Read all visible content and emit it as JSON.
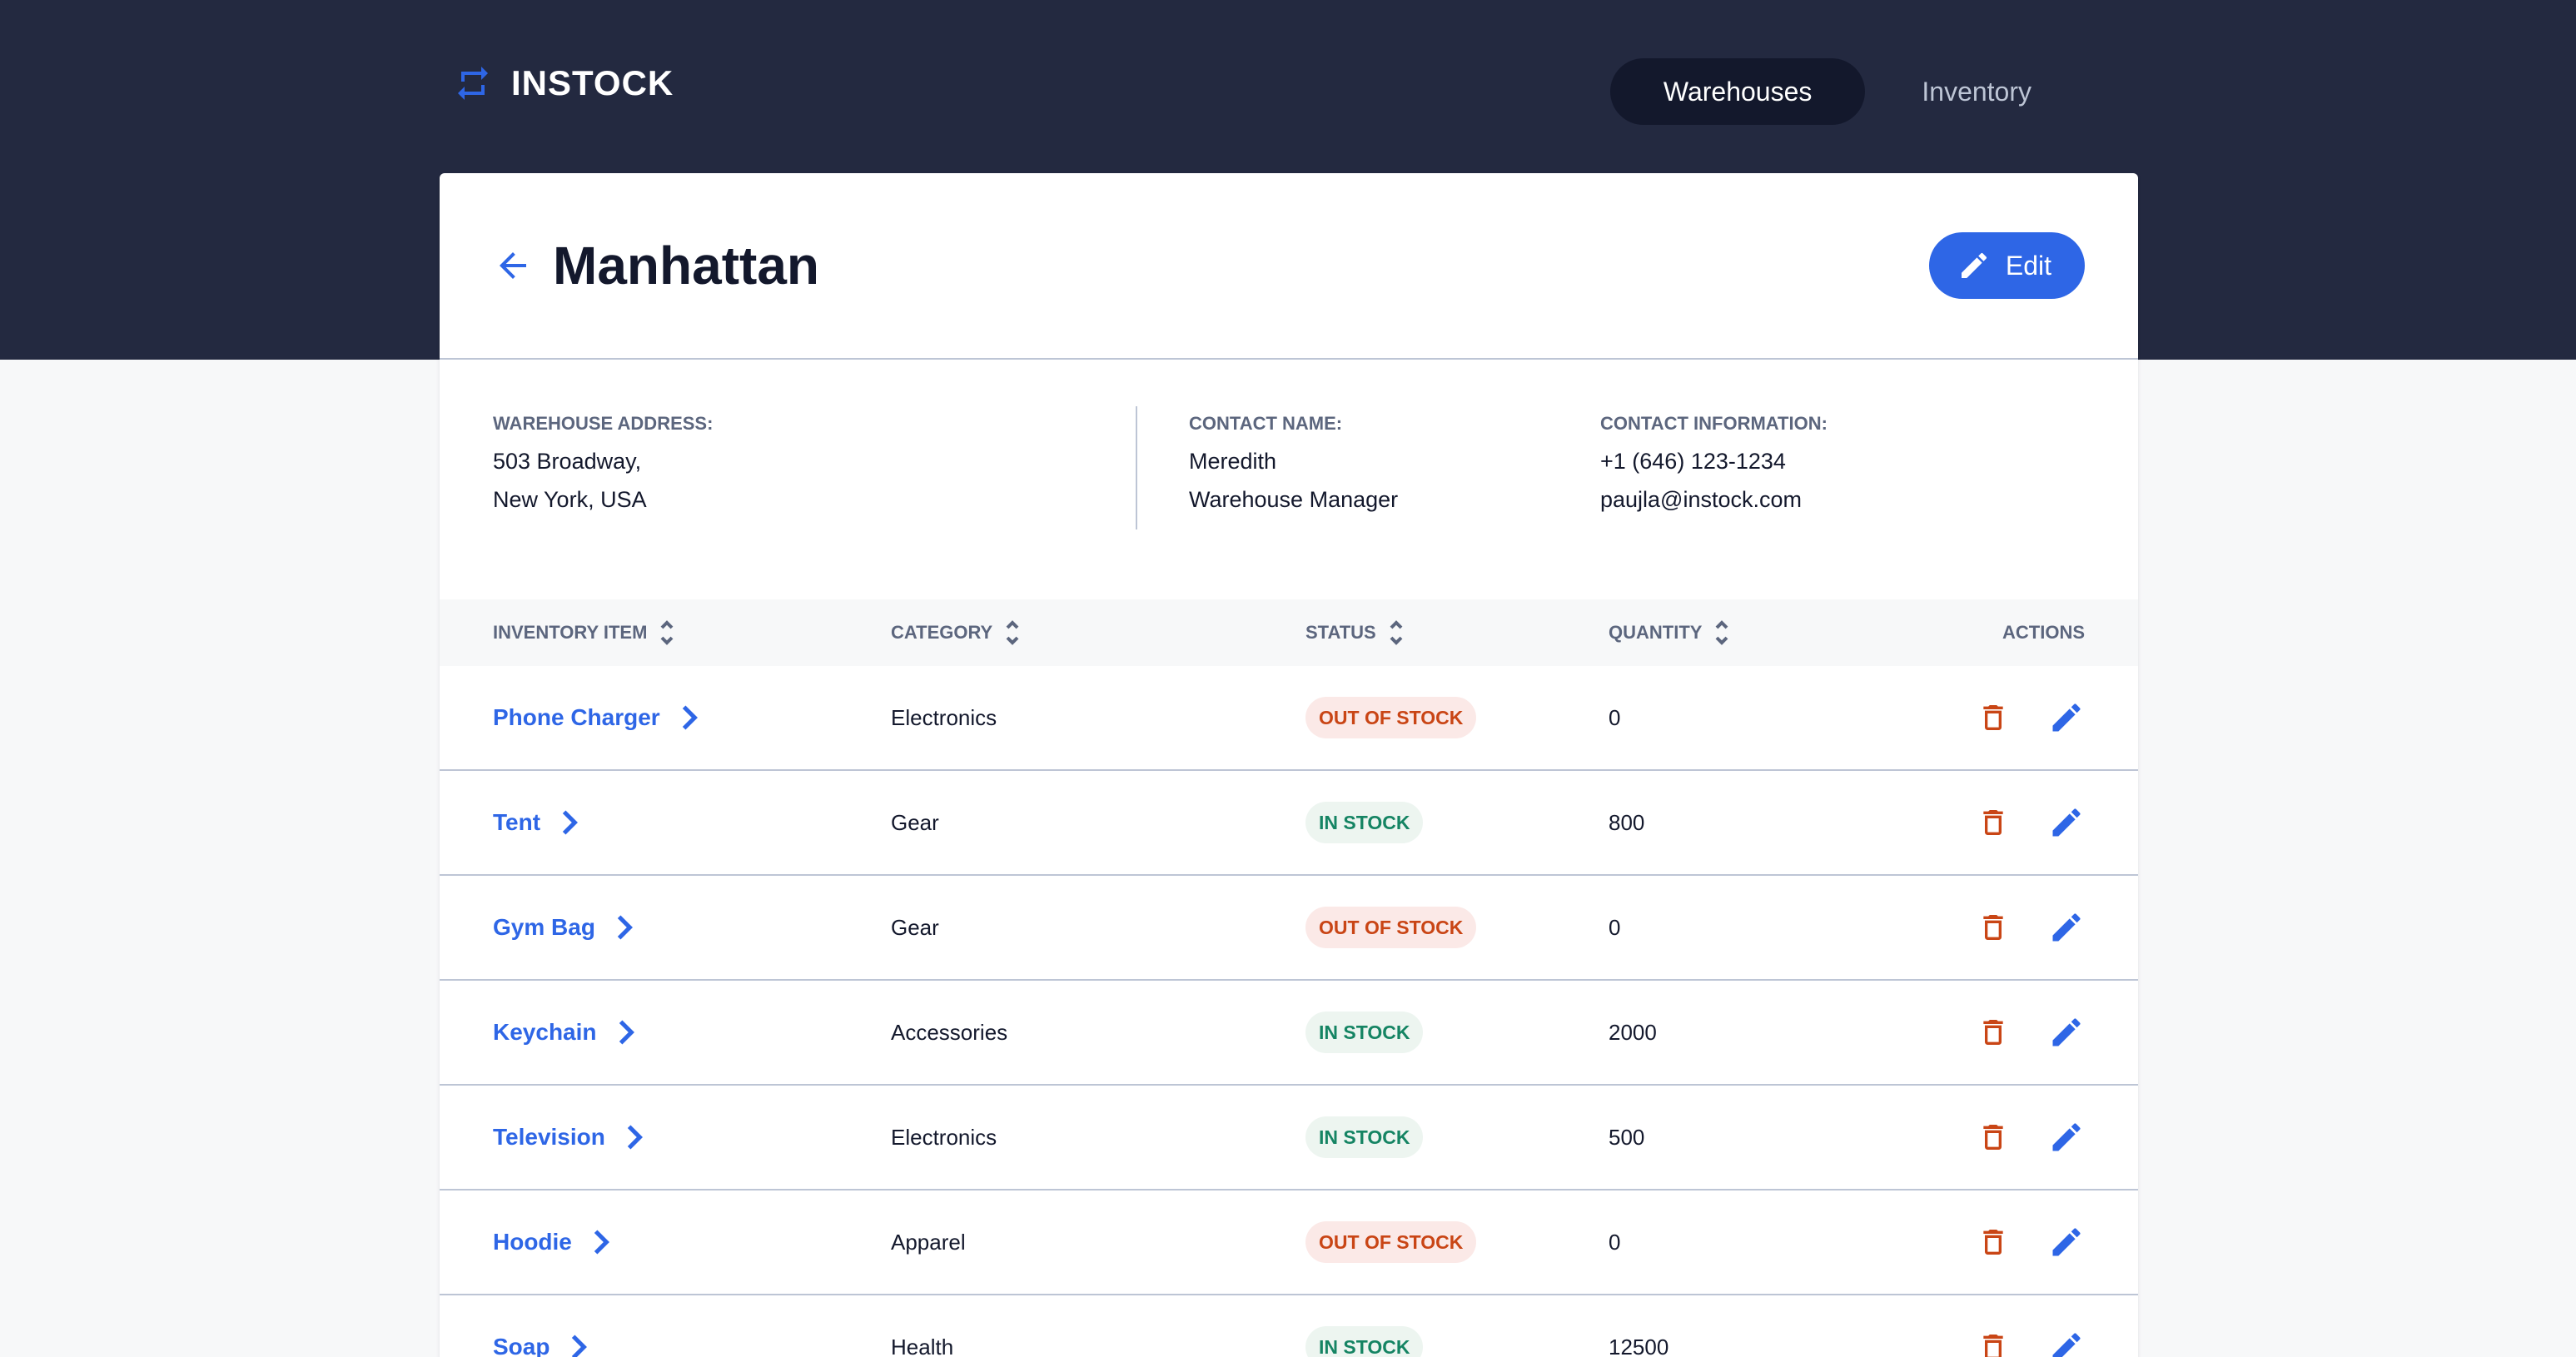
{
  "brand": {
    "name": "INSTOCK"
  },
  "nav": [
    {
      "label": "Warehouses",
      "active": true
    },
    {
      "label": "Inventory",
      "active": false
    }
  ],
  "warehouse": {
    "title": "Manhattan",
    "edit_label": "Edit"
  },
  "details": {
    "address_label": "WAREHOUSE ADDRESS:",
    "address_line1": "503 Broadway,",
    "address_line2": "New York, USA",
    "contact_label": "CONTACT NAME:",
    "contact_name": "Meredith",
    "contact_position": "Warehouse Manager",
    "info_label": "CONTACT INFORMATION:",
    "phone": "+1 (646) 123-1234",
    "email": "paujla@instock.com"
  },
  "table": {
    "headers": [
      "INVENTORY ITEM",
      "CATEGORY",
      "STATUS",
      "QUANTITY",
      "ACTIONS"
    ],
    "rows": [
      {
        "item": "Phone Charger",
        "category": "Electronics",
        "status": "OUT OF STOCK",
        "quantity": "0"
      },
      {
        "item": "Tent",
        "category": "Gear",
        "status": "IN STOCK",
        "quantity": "800"
      },
      {
        "item": "Gym Bag",
        "category": "Gear",
        "status": "OUT OF STOCK",
        "quantity": "0"
      },
      {
        "item": "Keychain",
        "category": "Accessories",
        "status": "IN STOCK",
        "quantity": "2000"
      },
      {
        "item": "Television",
        "category": "Electronics",
        "status": "IN STOCK",
        "quantity": "500"
      },
      {
        "item": "Hoodie",
        "category": "Apparel",
        "status": "OUT OF STOCK",
        "quantity": "0"
      },
      {
        "item": "Soap",
        "category": "Health",
        "status": "IN STOCK",
        "quantity": "12500"
      }
    ]
  },
  "colors": {
    "header_bg": "#232940",
    "accent": "#2e66e6",
    "out_of_stock": "#c94515",
    "in_stock": "#158463",
    "delete": "#c94515"
  },
  "icons": {
    "logo": "swap-arrows-icon",
    "back": "arrow-back-icon",
    "edit": "pencil-icon",
    "sort": "sort-icon",
    "chevron": "chevron-right-icon",
    "delete": "trash-icon"
  }
}
